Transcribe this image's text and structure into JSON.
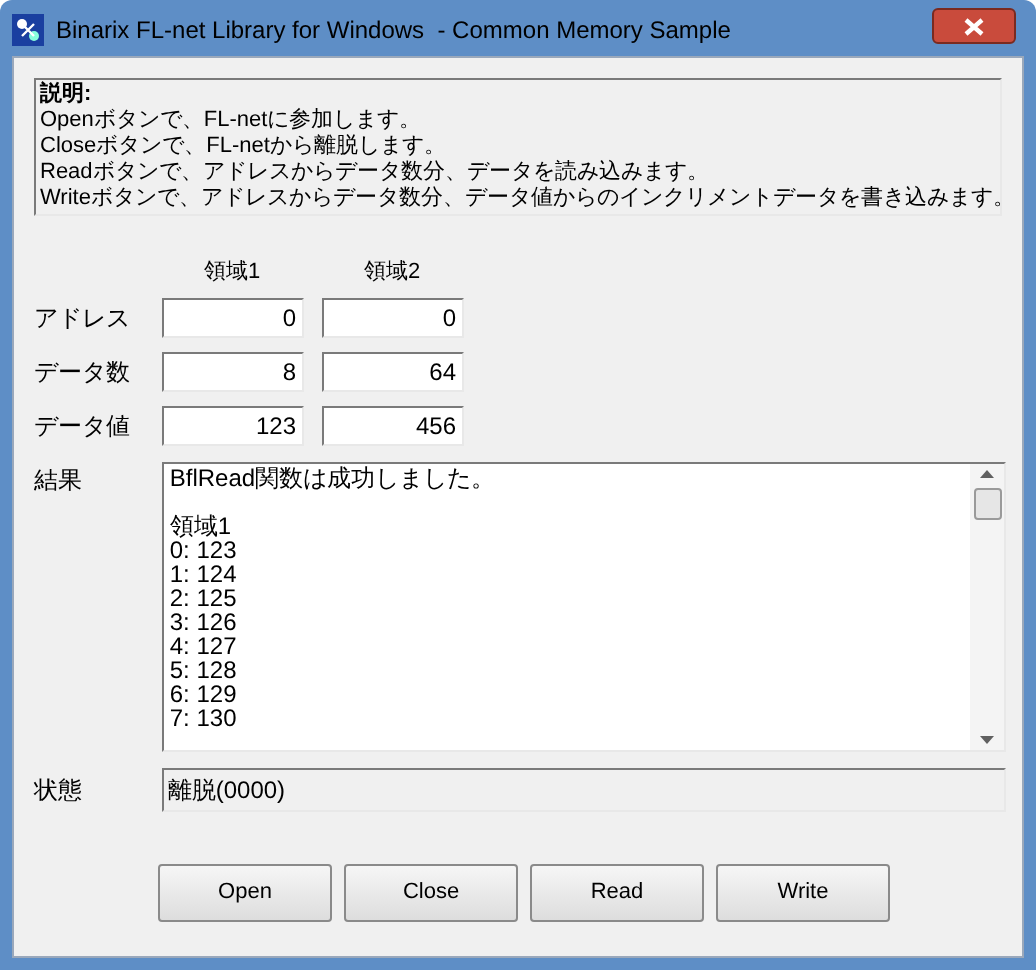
{
  "window": {
    "title": "Binarix FL-net Library for Windows  - Common Memory Sample"
  },
  "description": {
    "heading": "説明:",
    "lines": [
      "Openボタンで、FL-netに参加します。",
      "Closeボタンで、FL-netから離脱します。",
      "Readボタンで、アドレスからデータ数分、データを読み込みます。",
      "Writeボタンで、アドレスからデータ数分、データ値からのインクリメントデータを書き込みます。"
    ]
  },
  "columns": [
    "領域1",
    "領域2"
  ],
  "fields": [
    {
      "label": "アドレス",
      "values": [
        "0",
        "0"
      ]
    },
    {
      "label": "データ数",
      "values": [
        "8",
        "64"
      ]
    },
    {
      "label": "データ値",
      "values": [
        "123",
        "456"
      ]
    }
  ],
  "result": {
    "label": "結果",
    "message": "BflRead関数は成功しました。",
    "section": "領域1",
    "lines": [
      "0: 123",
      "1: 124",
      "2: 125",
      "3: 126",
      "4: 127",
      "5: 128",
      "6: 129",
      "7: 130"
    ]
  },
  "status": {
    "label": "状態",
    "value": "離脱(0000)"
  },
  "buttons": [
    "Open",
    "Close",
    "Read",
    "Write"
  ]
}
